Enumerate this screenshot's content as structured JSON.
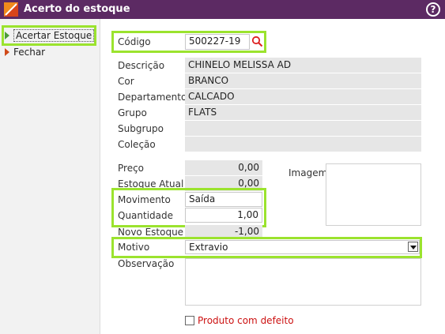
{
  "window": {
    "title": "Acerto do estoque",
    "help_icon": "?"
  },
  "sidebar": {
    "items": [
      {
        "label": "Acertar Estoque",
        "active": true
      },
      {
        "label": "Fechar",
        "active": false
      }
    ]
  },
  "form": {
    "codigo": {
      "label": "Código",
      "value": "500227-19"
    },
    "descricao": {
      "label": "Descrição",
      "value": "CHINELO MELISSA AD"
    },
    "cor": {
      "label": "Cor",
      "value": "BRANCO"
    },
    "departamento": {
      "label": "Departamento",
      "value": "CALCADO"
    },
    "grupo": {
      "label": "Grupo",
      "value": "FLATS"
    },
    "subgrupo": {
      "label": "Subgrupo",
      "value": ""
    },
    "colecao": {
      "label": "Coleção",
      "value": ""
    },
    "preco": {
      "label": "Preço",
      "value": "0,00"
    },
    "estoque_atual": {
      "label": "Estoque Atual",
      "value": "0,00"
    },
    "imagem": {
      "label": "Imagem"
    },
    "movimento": {
      "label": "Movimento",
      "value": "Saída"
    },
    "quantidade": {
      "label": "Quantidade",
      "value": "1,00"
    },
    "novo_estoque": {
      "label": "Novo Estoque",
      "value": "-1,00"
    },
    "motivo": {
      "label": "Motivo",
      "value": "Extravio"
    },
    "observacao": {
      "label": "Observação",
      "value": ""
    },
    "produto_defeito": {
      "label": "Produto com defeito",
      "checked": false
    }
  },
  "colors": {
    "titlebar": "#5c2a63",
    "highlight": "#9be32e",
    "readonly_field": "#e6e6e6",
    "checkbox_label": "#cc1111"
  }
}
